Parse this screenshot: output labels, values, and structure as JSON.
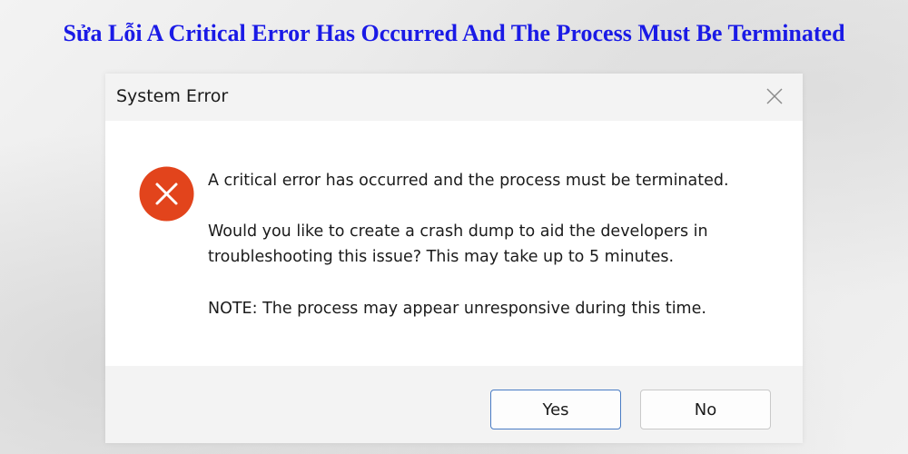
{
  "headline": "Sửa Lỗi A Critical Error Has Occurred And The Process Must Be Terminated",
  "dialog": {
    "title": "System Error",
    "close_icon": "close-icon",
    "error_icon": "error-circle-x-icon",
    "message_lines": [
      "A critical error has occurred and the process must be terminated.",
      "Would you like to create a crash dump to aid the developers in",
      "troubleshooting this issue? This may take up to 5 minutes.",
      "NOTE: The process may appear unresponsive during this time."
    ],
    "buttons": {
      "yes_label": "Yes",
      "no_label": "No"
    }
  },
  "colors": {
    "headline": "#1a1ae6",
    "error_icon": "#e2441c",
    "default_button_border": "#4a7cc4",
    "titlebar_bg": "#f3f3f3",
    "footer_bg": "#f3f3f3"
  }
}
